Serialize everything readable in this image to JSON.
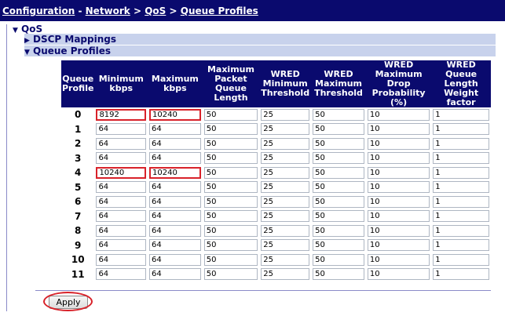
{
  "breadcrumb": {
    "items": [
      "Configuration",
      "Network",
      "QoS",
      "Queue Profiles"
    ],
    "separator": ">"
  },
  "tree": {
    "root": "QoS",
    "dscp": "DSCP Mappings",
    "queue_profiles": "Queue Profiles"
  },
  "table": {
    "headers": [
      "Queue Profile",
      "Minimum kbps",
      "Maximum kbps",
      "Maximum Packet Queue Length",
      "WRED Minimum Threshold",
      "WRED Maximum Threshold",
      "WRED Maximum Drop Probability (%)",
      "WRED Queue Length Weight factor"
    ],
    "rows": [
      [
        "0",
        "8192",
        "10240",
        "50",
        "25",
        "50",
        "10",
        "1"
      ],
      [
        "1",
        "64",
        "64",
        "50",
        "25",
        "50",
        "10",
        "1"
      ],
      [
        "2",
        "64",
        "64",
        "50",
        "25",
        "50",
        "10",
        "1"
      ],
      [
        "3",
        "64",
        "64",
        "50",
        "25",
        "50",
        "10",
        "1"
      ],
      [
        "4",
        "10240",
        "10240",
        "50",
        "25",
        "50",
        "10",
        "1"
      ],
      [
        "5",
        "64",
        "64",
        "50",
        "25",
        "50",
        "10",
        "1"
      ],
      [
        "6",
        "64",
        "64",
        "50",
        "25",
        "50",
        "10",
        "1"
      ],
      [
        "7",
        "64",
        "64",
        "50",
        "25",
        "50",
        "10",
        "1"
      ],
      [
        "8",
        "64",
        "64",
        "50",
        "25",
        "50",
        "10",
        "1"
      ],
      [
        "9",
        "64",
        "64",
        "50",
        "25",
        "50",
        "10",
        "1"
      ],
      [
        "10",
        "64",
        "64",
        "50",
        "25",
        "50",
        "10",
        "1"
      ],
      [
        "11",
        "64",
        "64",
        "50",
        "25",
        "50",
        "10",
        "1"
      ]
    ]
  },
  "highlighted_fields": [
    "row0-min",
    "row0-max",
    "row4-min",
    "row4-max"
  ],
  "apply_label": "Apply",
  "colors": {
    "header_bg": "#0a0a6e",
    "highlight": "#d8222a",
    "tree_row_bg": "#c8d2ec"
  }
}
